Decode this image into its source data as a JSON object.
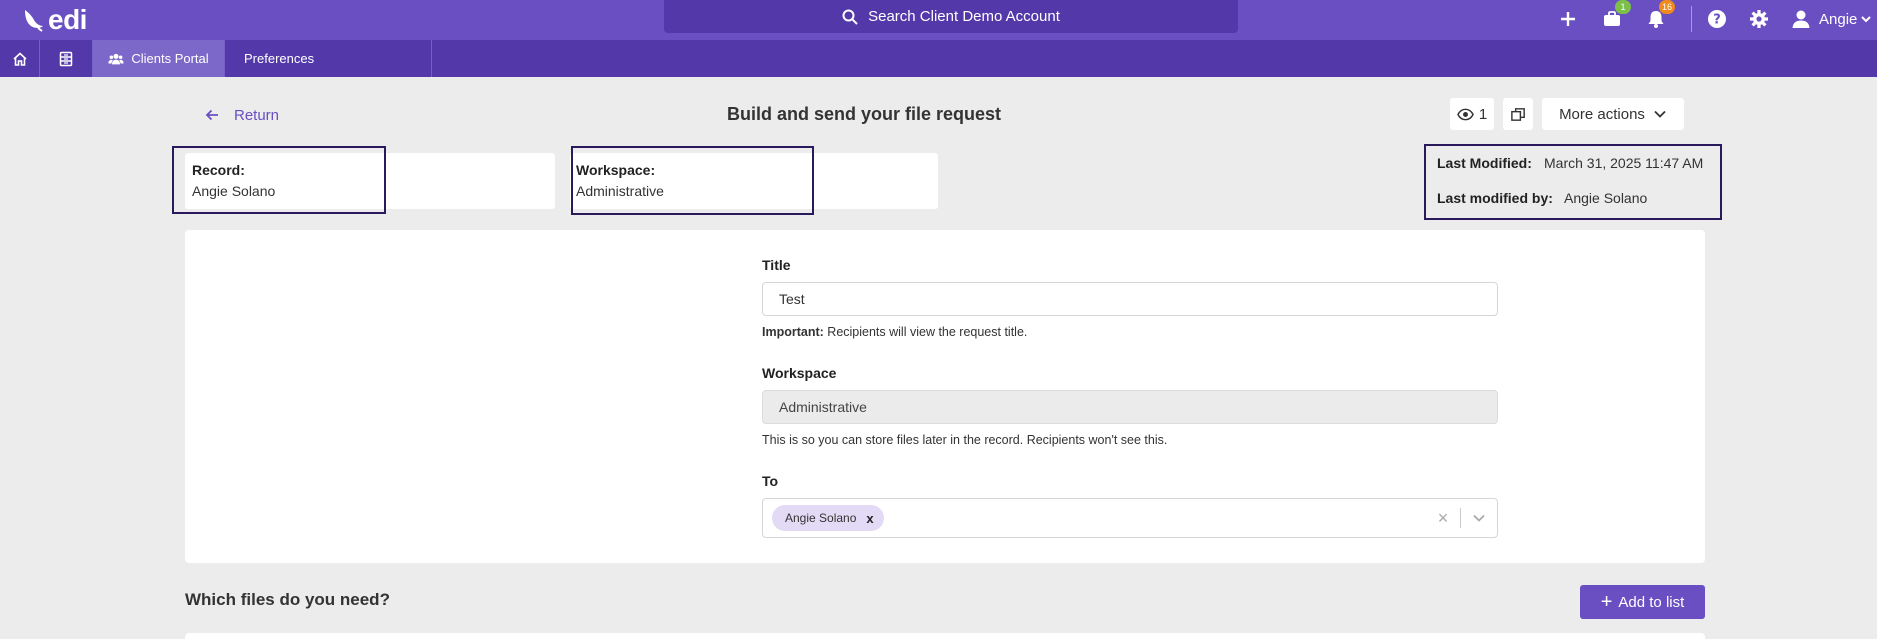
{
  "app": {
    "logo_text": "edi",
    "search_placeholder": "Search Client Demo Account"
  },
  "topbar": {
    "icons": [
      "plus-icon",
      "briefcase-icon",
      "bell-icon",
      "help-icon",
      "gear-icon"
    ],
    "briefcase_badge": "1",
    "bell_badge": "16",
    "user_name": "Angie"
  },
  "subnav": {
    "items": [
      {
        "label": "",
        "icon": "home-icon"
      },
      {
        "label": "",
        "icon": "records-icon"
      },
      {
        "label": "Clients Portal",
        "icon": "users-icon"
      },
      {
        "label": "Preferences"
      }
    ]
  },
  "header": {
    "return_label": "Return",
    "title": "Build and send your file request",
    "views_count": "1",
    "more_actions_label": "More actions"
  },
  "info": {
    "record_label": "Record:",
    "record_value": "Angie Solano",
    "workspace_label": "Workspace:",
    "workspace_value": "Administrative",
    "last_modified_label": "Last Modified:",
    "last_modified_value": "March 31, 2025 11:47 AM",
    "last_modified_by_label": "Last modified by:",
    "last_modified_by_value": "Angie Solano"
  },
  "form": {
    "title_label": "Title",
    "title_value": "Test",
    "title_help_strong": "Important:",
    "title_help": "Recipients will view the request title.",
    "workspace_label": "Workspace",
    "workspace_value": "Administrative",
    "workspace_help": "This is so you can store files later in the record. Recipients won't see this.",
    "to_label": "To",
    "to_chips": [
      "Angie Solano"
    ],
    "chip_remove": "x",
    "clear_symbol": "×"
  },
  "files": {
    "section_title": "Which files do you need?",
    "add_button_label": "Add to list",
    "add_button_plus": "+"
  }
}
